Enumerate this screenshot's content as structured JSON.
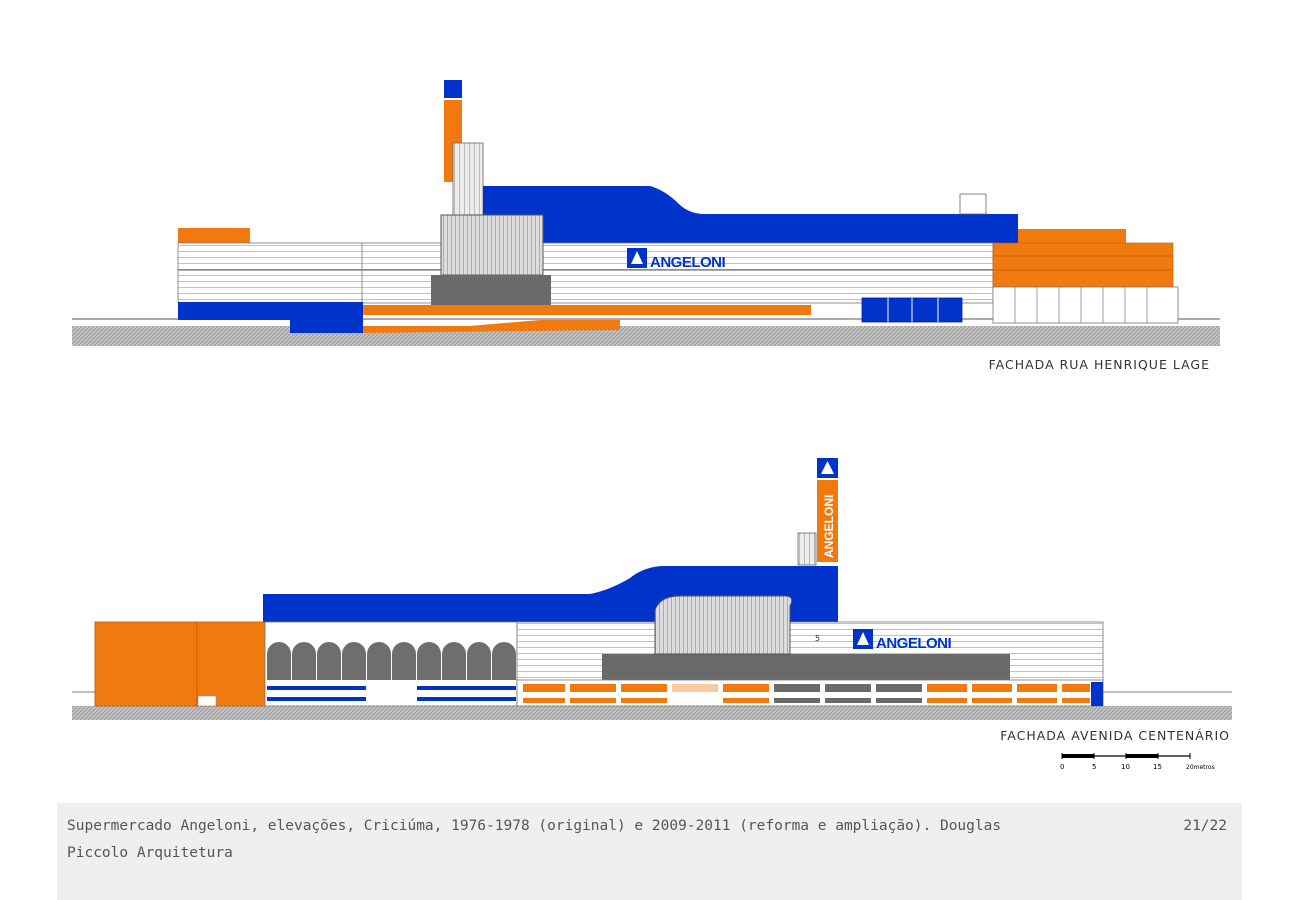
{
  "drawings": [
    {
      "title": "FACHADA RUA HENRIQUE LAGE",
      "sign_text": "ANGELONI"
    },
    {
      "title": "FACHADA AVENIDA CENTENÁRIO",
      "sign_text": "ANGELONI",
      "tower_text": "ANGELONI",
      "marker": "5"
    }
  ],
  "scale_bar": {
    "ticks": [
      "0",
      "5",
      "10",
      "15",
      "20metros"
    ]
  },
  "caption": {
    "text": "Supermercado Angeloni, elevações, Criciúma, 1976-1978 (original) e 2009-2011 (reforma e ampliação). Douglas Piccolo Arquitetura",
    "counter": "21/22"
  },
  "colors": {
    "blue": "#0033cc",
    "orange": "#f07a10",
    "gray_dark": "#6a6a6a",
    "ground": "#b5b5b5"
  }
}
